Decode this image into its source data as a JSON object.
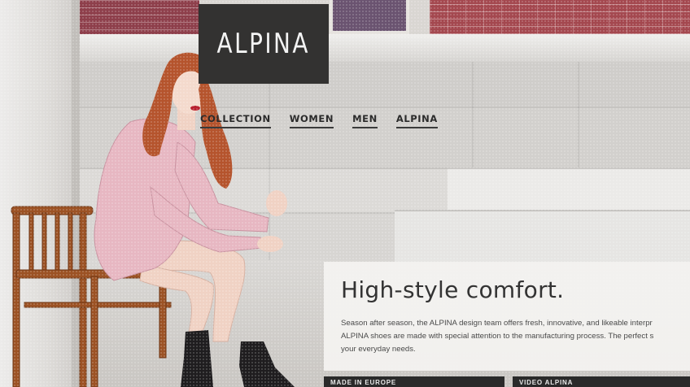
{
  "brand": {
    "logo_text": "ALPINA"
  },
  "nav": {
    "items": [
      {
        "label": "COLLECTION"
      },
      {
        "label": "WOMEN"
      },
      {
        "label": "MEN"
      },
      {
        "label": "ALPINA"
      }
    ]
  },
  "promo": {
    "heading": "High-style comfort.",
    "lines": [
      "Season after season, the ALPINA design team offers fresh, innovative, and likeable interpr",
      "ALPINA shoes are made with special attention to the manufacturing process. The perfect s",
      "your everyday needs."
    ]
  },
  "tabs": [
    {
      "label": "MADE IN EUROPE"
    },
    {
      "label": "VIDEO ALPINA"
    }
  ],
  "colors": {
    "logo_bg": "#333231",
    "nav_text": "#2b2b2b",
    "jacket": "#e7b7c2",
    "hair": "#b5542d",
    "chair": "#9c5224"
  }
}
